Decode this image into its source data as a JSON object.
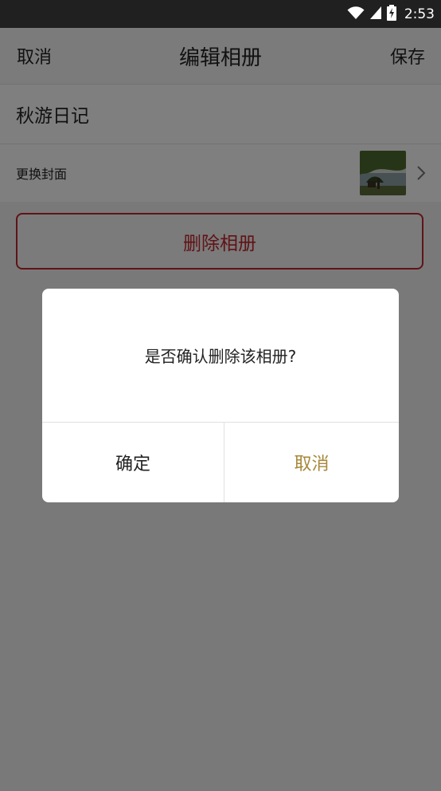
{
  "status_bar": {
    "time": "2:53",
    "icons": [
      "wifi-icon",
      "signal-icon",
      "battery-charging-icon"
    ]
  },
  "app_bar": {
    "left_label": "取消",
    "title": "编辑相册",
    "right_label": "保存"
  },
  "album": {
    "name": "秋游日记"
  },
  "cover_row": {
    "label": "更换封面",
    "thumbnail": "cover-thumbnail",
    "icon": "chevron-right-icon"
  },
  "delete_button": {
    "label": "删除相册",
    "color": "#c0262d"
  },
  "dialog": {
    "message": "是否确认删除该相册?",
    "confirm_label": "确定",
    "cancel_label": "取消",
    "cancel_color": "#a7883a"
  }
}
